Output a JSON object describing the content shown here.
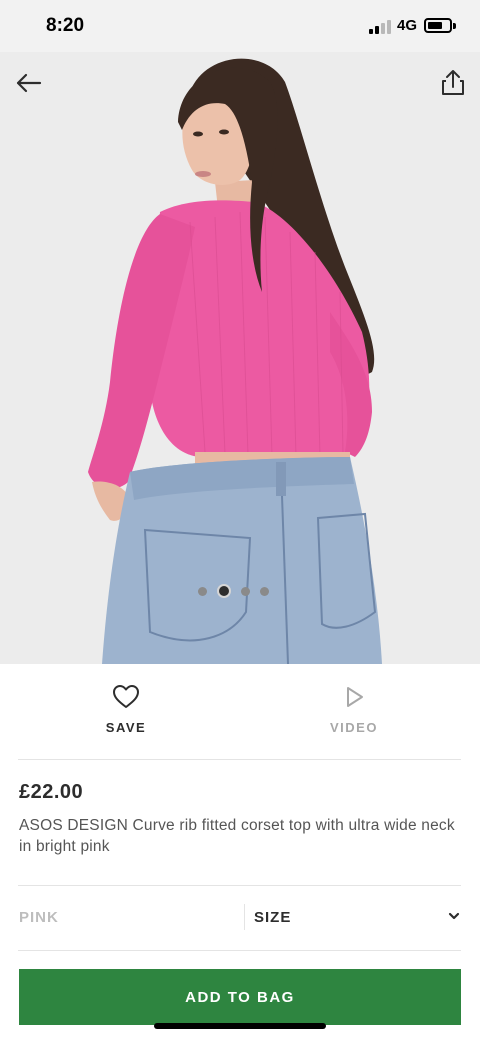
{
  "status_bar": {
    "time": "8:20",
    "network": "4G",
    "battery_level": 0.7
  },
  "hero": {
    "back_icon": "arrow-left-icon",
    "share_icon": "share-icon",
    "carousel": {
      "total": 4,
      "active_index": 1
    }
  },
  "actions": {
    "save": {
      "label": "SAVE",
      "icon": "heart-icon"
    },
    "video": {
      "label": "VIDEO",
      "icon": "play-icon"
    }
  },
  "product": {
    "price": "£22.00",
    "title": "ASOS DESIGN Curve rib fitted corset top with ultra wide neck in bright pink"
  },
  "selectors": {
    "colour": "PINK",
    "size_label": "SIZE",
    "size_icon": "chevron-down-icon"
  },
  "cta": {
    "label": "ADD TO BAG"
  },
  "colors": {
    "accent_green": "#2e8540",
    "top_pink": "#ec5aa2",
    "denim_blue": "#9db3ce",
    "text_dark": "#2d2d2d",
    "text_muted": "#a8a8a8"
  }
}
